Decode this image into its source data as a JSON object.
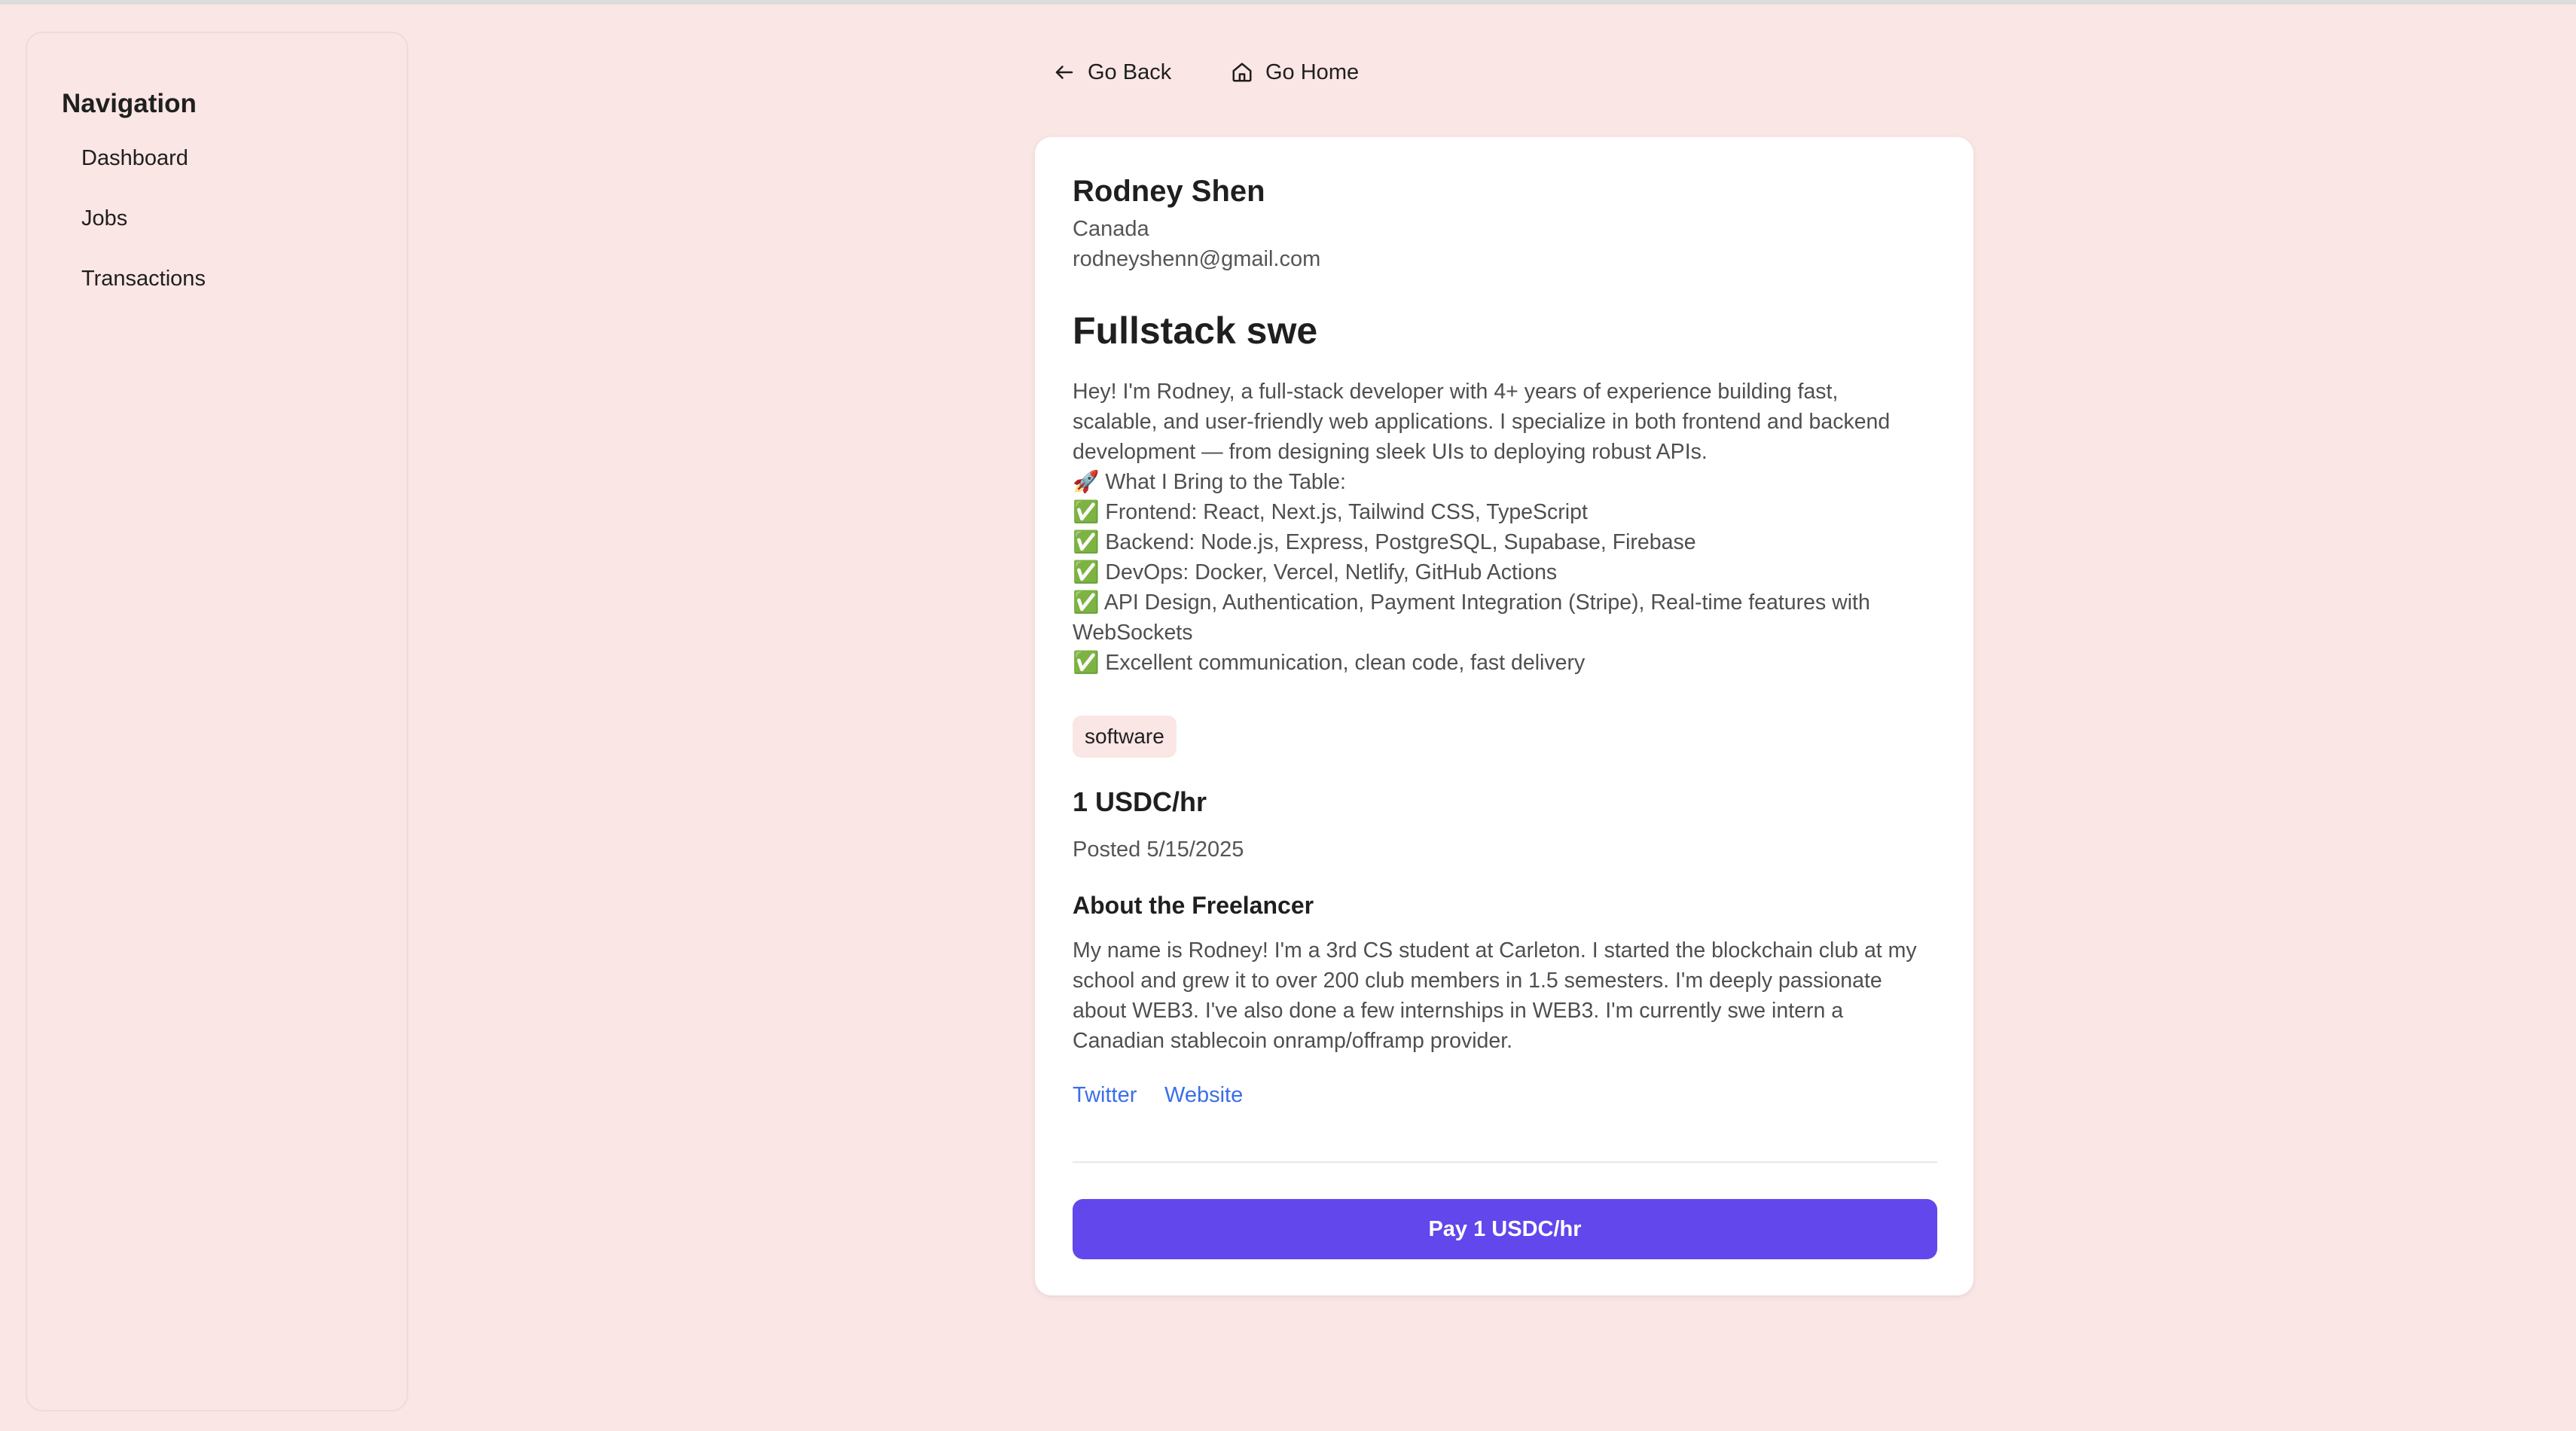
{
  "sidebar": {
    "title": "Navigation",
    "items": [
      {
        "label": "Dashboard"
      },
      {
        "label": "Jobs"
      },
      {
        "label": "Transactions"
      }
    ]
  },
  "topnav": {
    "back_label": "Go Back",
    "home_label": "Go Home"
  },
  "profile": {
    "name": "Rodney Shen",
    "country": "Canada",
    "email": "rodneyshenn@gmail.com"
  },
  "job": {
    "title": "Fullstack swe",
    "description_lines": [
      "Hey! I'm Rodney, a full-stack developer with 4+ years of experience building fast,",
      "scalable, and user-friendly web applications. I specialize in both frontend and backend",
      "development — from designing sleek UIs to deploying robust APIs.",
      "🚀 What I Bring to the Table:",
      "✅ Frontend: React, Next.js, Tailwind CSS, TypeScript",
      "✅ Backend: Node.js, Express, PostgreSQL, Supabase, Firebase",
      "✅ DevOps: Docker, Vercel, Netlify, GitHub Actions",
      "✅ API Design, Authentication, Payment Integration (Stripe), Real-time features with",
      "WebSockets",
      "✅ Excellent communication, clean code, fast delivery"
    ],
    "tag": "software",
    "rate": "1 USDC/hr",
    "posted": "Posted 5/15/2025"
  },
  "about": {
    "title": "About the Freelancer",
    "text_lines": [
      "My name is Rodney! I'm a 3rd CS student at Carleton. I started the blockchain club at my",
      "school and grew it to over 200 club members in 1.5 semesters. I'm deeply passionate",
      "about WEB3. I've also done a few internships in WEB3. I'm currently swe intern a",
      "Canadian stablecoin onramp/offramp provider."
    ],
    "links": {
      "twitter": "Twitter",
      "website": "Website"
    }
  },
  "actions": {
    "pay_label": "Pay 1 USDC/hr"
  },
  "colors": {
    "background": "#fae6e4",
    "accent": "#6247ec",
    "link": "#3b6ee8"
  },
  "icons": {
    "back": "arrow-left-icon",
    "home": "home-icon"
  }
}
